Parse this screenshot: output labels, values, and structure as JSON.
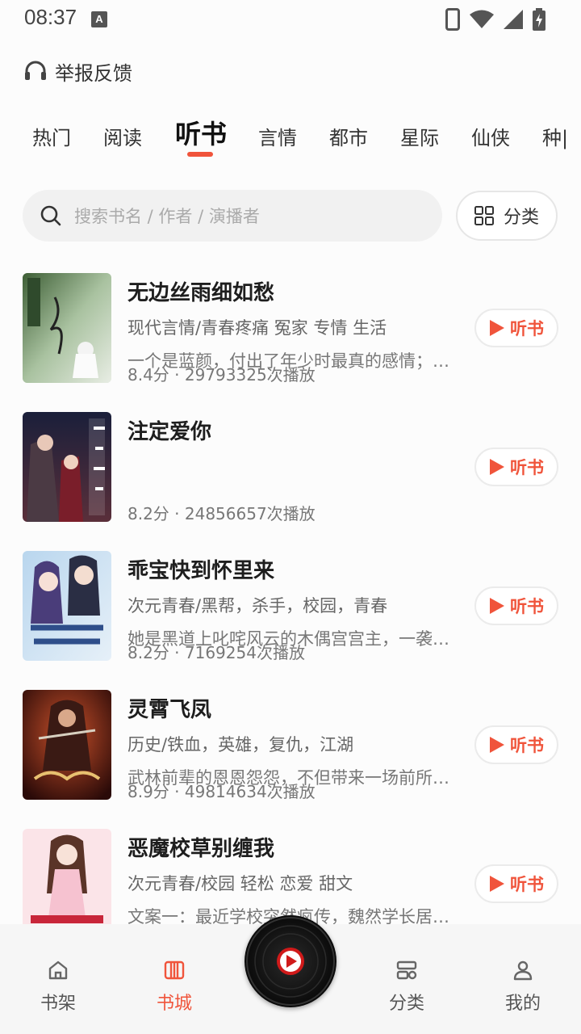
{
  "status": {
    "time": "08:37",
    "a_icon_label": "A"
  },
  "report": {
    "label": "举报反馈"
  },
  "tabs": [
    "热门",
    "阅读",
    "听书",
    "言情",
    "都市",
    "星际",
    "仙侠",
    "种|"
  ],
  "active_tab": "听书",
  "search": {
    "placeholder": "搜索书名 / 作者 / 演播者"
  },
  "category_button": {
    "label": "分类"
  },
  "books": [
    {
      "title": "无边丝雨细如愁",
      "tags": "现代言情/青春疼痛 冤家 专情 生活",
      "desc": "一个是蓝颜，付出了年少时最真的感情；…",
      "stat": "8.4分 · 29793325次播放",
      "button": "听书"
    },
    {
      "title": "注定爱你",
      "tags": "",
      "desc": "",
      "stat": "8.2分 · 24856657次播放",
      "button": "听书"
    },
    {
      "title": "乖宝快到怀里来",
      "tags": "次元青春/黑帮，杀手，校园，青春",
      "desc": "她是黑道上叱咤风云的木偶宫宫主，一袭…",
      "stat": "8.2分 · 7169254次播放",
      "button": "听书"
    },
    {
      "title": "灵霄飞凤",
      "tags": "历史/铁血，英雄，复仇，江湖",
      "desc": "武林前辈的恩恩怨怨，不但带来一场前所…",
      "stat": "8.9分 · 49814634次播放",
      "button": "听书"
    },
    {
      "title": "恶魔校草别缠我",
      "tags": "次元青春/校园 轻松 恋爱 甜文",
      "desc": "文案一：最近学校突然疯传，魏然学长居…",
      "stat": "",
      "button": "听书"
    }
  ],
  "nav": [
    {
      "label": "书架",
      "icon": "home-icon"
    },
    {
      "label": "书城",
      "icon": "bookstore-icon"
    },
    {
      "label": "分类",
      "icon": "category-icon"
    },
    {
      "label": "我的",
      "icon": "profile-icon"
    }
  ],
  "colors": {
    "accent": "#f0543b"
  }
}
